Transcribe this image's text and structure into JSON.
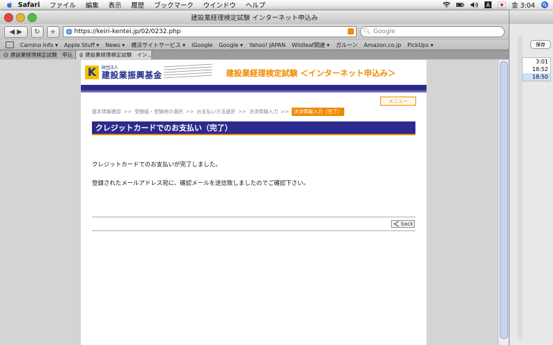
{
  "menubar": {
    "app": "Safari",
    "items": [
      "ファイル",
      "編集",
      "表示",
      "履歴",
      "ブックマーク",
      "ウインドウ",
      "ヘルプ"
    ],
    "clock": "金 3:04"
  },
  "window": {
    "title": "建設業経理検定試験 インターネット申込み",
    "url": "https://keiri-kentei.jp/02/0232.php",
    "search_placeholder": "Google",
    "bookmarks": [
      "Camino Info ▾",
      "Apple Stuff ▾",
      "News ▾",
      "横浜サイトサービス ▾",
      "iGoogle",
      "Google ▾",
      "Yahoo! JAPAN",
      "Wildleaf関連 ▾",
      "ガルーン",
      "Amazon.co.jp",
      "PickUps ▾"
    ],
    "tabs": [
      {
        "label": "建設業経理検定試験　申込",
        "active": false
      },
      {
        "label": "建設業経理検定試験　イン…",
        "active": true
      }
    ]
  },
  "page": {
    "logo_small": "財団法人",
    "logo_big": "建設業振興基金",
    "logo_k": "K",
    "header_title": "建設業経理検定試験 ＜インターネット申込み＞",
    "menu_label": "メニュー",
    "breadcrumb": [
      "基本情報確認",
      ">>",
      "受験級・受験地の選択",
      ">>",
      "お支払い方法選択",
      ">>",
      "決済情報入力",
      ">>"
    ],
    "breadcrumb_current": "決済情報入力（完了）",
    "heading": "クレジットカードでのお支払い（完了）",
    "message1": "クレジットカードでのお支払いが完了しました。",
    "message2": "登録されたメールアドレス宛に、確認メールを送信致しましたのでご確認下さい。",
    "back_label": "back"
  },
  "side_window": {
    "save_label": "保存",
    "times": [
      "3:01",
      "18:52",
      "18:50"
    ]
  },
  "colors": {
    "navy": "#2c2a8c",
    "orange": "#f08a00"
  }
}
